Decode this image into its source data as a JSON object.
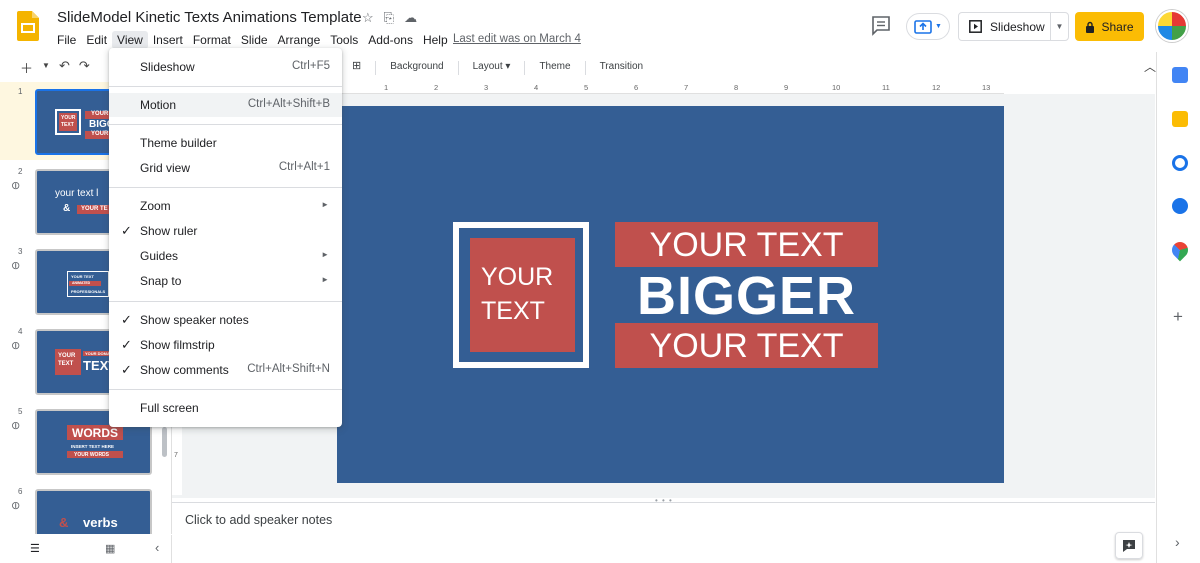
{
  "header": {
    "title": "SlideModel Kinetic Texts Animations Template",
    "last_edit": "Last edit was on March 4",
    "slideshow_label": "Slideshow",
    "share_label": "Share"
  },
  "menubar": {
    "items": [
      "File",
      "Edit",
      "View",
      "Insert",
      "Format",
      "Slide",
      "Arrange",
      "Tools",
      "Add-ons",
      "Help"
    ],
    "active": "View"
  },
  "toolbar": {
    "background_label": "Background",
    "layout_label": "Layout",
    "theme_label": "Theme",
    "transition_label": "Transition"
  },
  "ruler": {
    "ticks": [
      "1",
      "2",
      "3",
      "4",
      "5",
      "6",
      "7",
      "8",
      "9",
      "10",
      "11",
      "12",
      "13"
    ],
    "vertical_tick": "7"
  },
  "view_menu": {
    "slideshow": {
      "label": "Slideshow",
      "shortcut": "Ctrl+F5"
    },
    "motion": {
      "label": "Motion",
      "shortcut": "Ctrl+Alt+Shift+B"
    },
    "theme_builder": {
      "label": "Theme builder"
    },
    "grid_view": {
      "label": "Grid view",
      "shortcut": "Ctrl+Alt+1"
    },
    "zoom": {
      "label": "Zoom"
    },
    "show_ruler": {
      "label": "Show ruler",
      "checked": true
    },
    "guides": {
      "label": "Guides"
    },
    "snap_to": {
      "label": "Snap to"
    },
    "show_speaker_notes": {
      "label": "Show speaker notes",
      "checked": true
    },
    "show_filmstrip": {
      "label": "Show filmstrip",
      "checked": true
    },
    "show_comments": {
      "label": "Show comments",
      "shortcut": "Ctrl+Alt+Shift+N",
      "checked": true
    },
    "full_screen": {
      "label": "Full screen"
    }
  },
  "filmstrip": {
    "slides": [
      {
        "num": "1",
        "t1": "YOUR",
        "t2": "TEXT",
        "t3": "YOUR",
        "t4": "BIGG",
        "t5": "YOUR"
      },
      {
        "num": "2",
        "t1": "your text l",
        "t2": "&",
        "t3": "YOUR TE"
      },
      {
        "num": "3",
        "t1": "YOUR TEXT",
        "t2": "ANIMATED",
        "t3": "PROFESSIONALS"
      },
      {
        "num": "4",
        "t1": "YOUR",
        "t2": "TEXT",
        "t3": "TEXT",
        "t4": "YOUR DOMAIN"
      },
      {
        "num": "5",
        "t1": "WORDS",
        "t2": "INSERT TEXT HERE",
        "t3": "YOUR WORDS"
      },
      {
        "num": "6",
        "t1": "&",
        "t2": "verbs"
      }
    ]
  },
  "slide": {
    "box_line1": "YOUR",
    "box_line2": "TEXT",
    "bar_top": "YOUR TEXT",
    "big": "BIGGER",
    "bar_bottom": "YOUR TEXT"
  },
  "notes": {
    "placeholder": "Click to add speaker notes"
  },
  "colors": {
    "slide_bg": "#345e94",
    "accent_red": "#c0504d",
    "share_yellow": "#fbbc04"
  }
}
